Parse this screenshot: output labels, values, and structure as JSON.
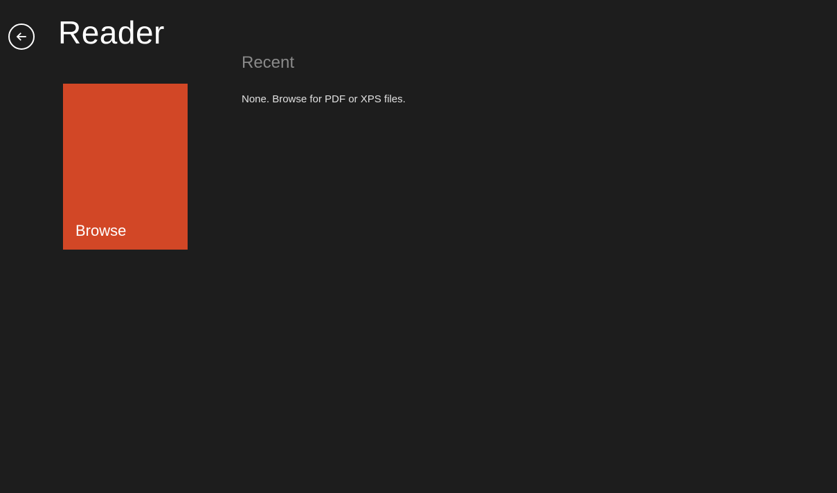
{
  "header": {
    "app_title": "Reader"
  },
  "browse_tile": {
    "label": "Browse",
    "color": "#d24726"
  },
  "recent": {
    "heading": "Recent",
    "empty_text": "None. Browse for PDF or XPS files."
  }
}
